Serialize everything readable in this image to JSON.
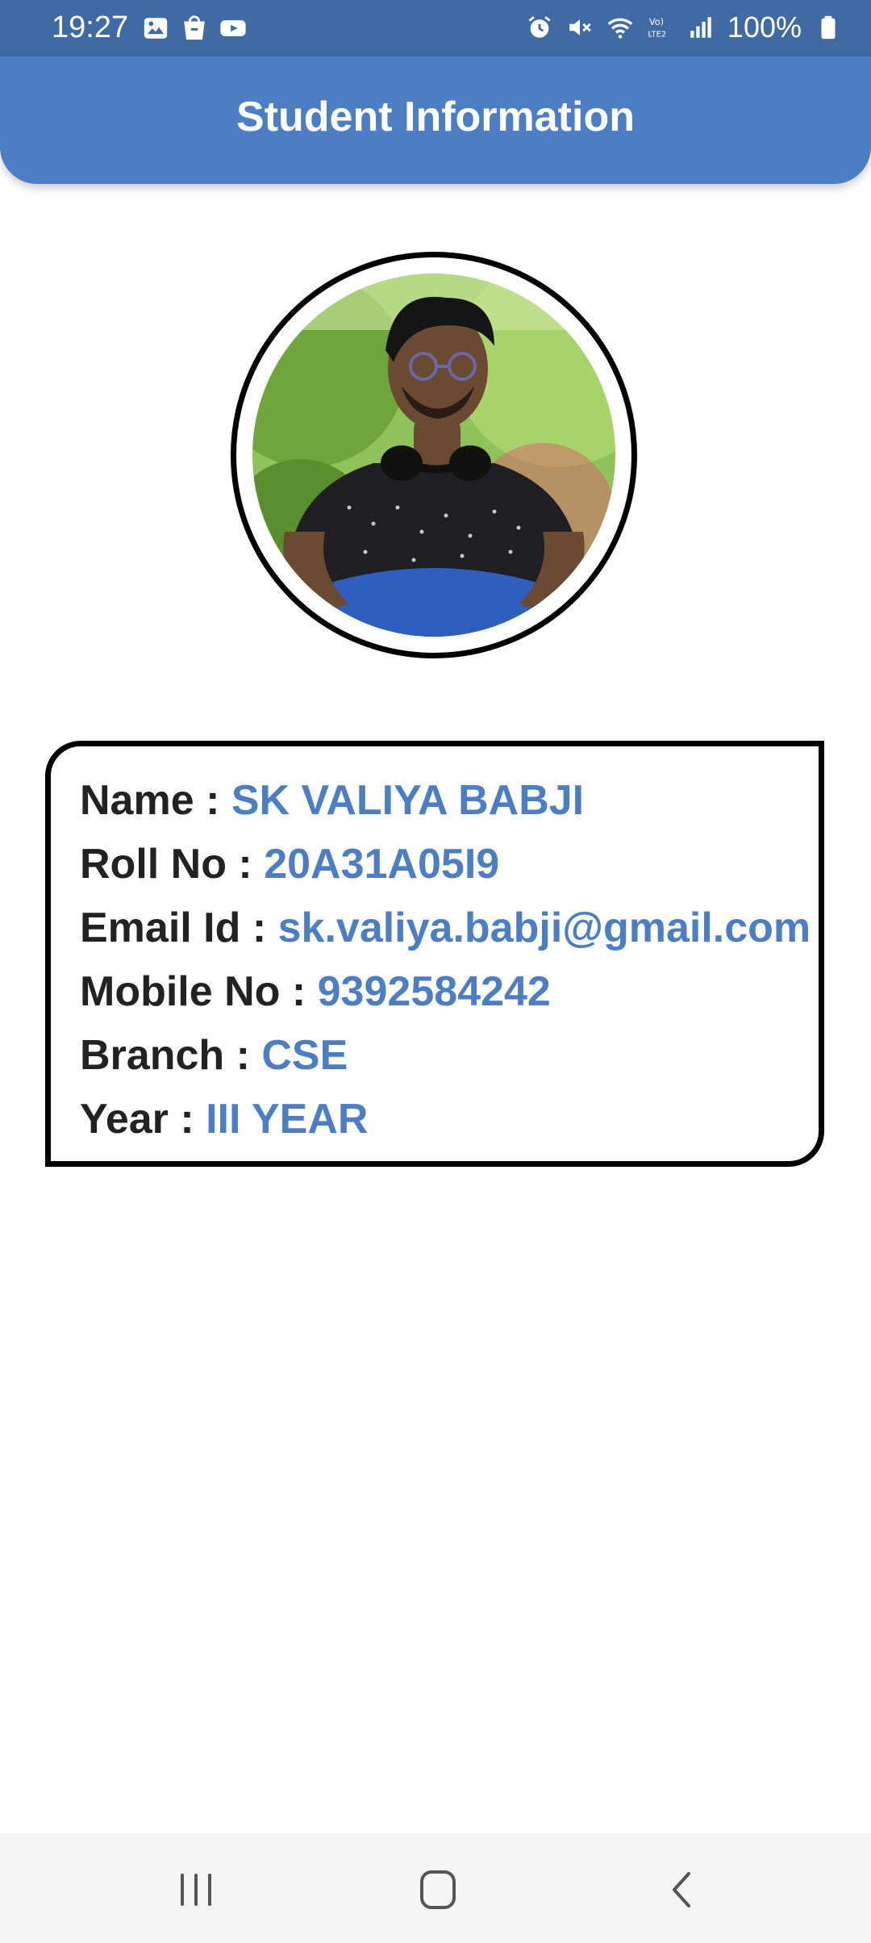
{
  "status_bar": {
    "time": "19:27",
    "battery": "100%",
    "left_icons": [
      "gallery-icon",
      "store-icon",
      "youtube-icon"
    ],
    "right_icons": [
      "alarm-icon",
      "mute-icon",
      "wifi-icon",
      "volte-lte2-icon",
      "signal-icon",
      "battery-icon"
    ]
  },
  "app_bar": {
    "title": "Student Information"
  },
  "profile": {
    "photo_alt": "Student profile photo"
  },
  "info": {
    "name": {
      "label": "Name : ",
      "value": "SK VALIYA BABJI"
    },
    "roll": {
      "label": "Roll No : ",
      "value": "20A31A05I9"
    },
    "email": {
      "label": "Email Id : ",
      "value": "sk.valiya.babji@gmail.com"
    },
    "mobile": {
      "label": "Mobile No : ",
      "value": "9392584242"
    },
    "branch": {
      "label": "Branch : ",
      "value": "CSE"
    },
    "year": {
      "label": "Year : ",
      "value": "III YEAR"
    }
  },
  "colors": {
    "status_bar": "#3f6aa3",
    "app_bar": "#4d7ec3",
    "value_text": "#4d7ec3",
    "label_text": "#222222"
  },
  "nav": {
    "buttons": [
      "recent-apps-icon",
      "home-icon",
      "back-icon"
    ]
  }
}
